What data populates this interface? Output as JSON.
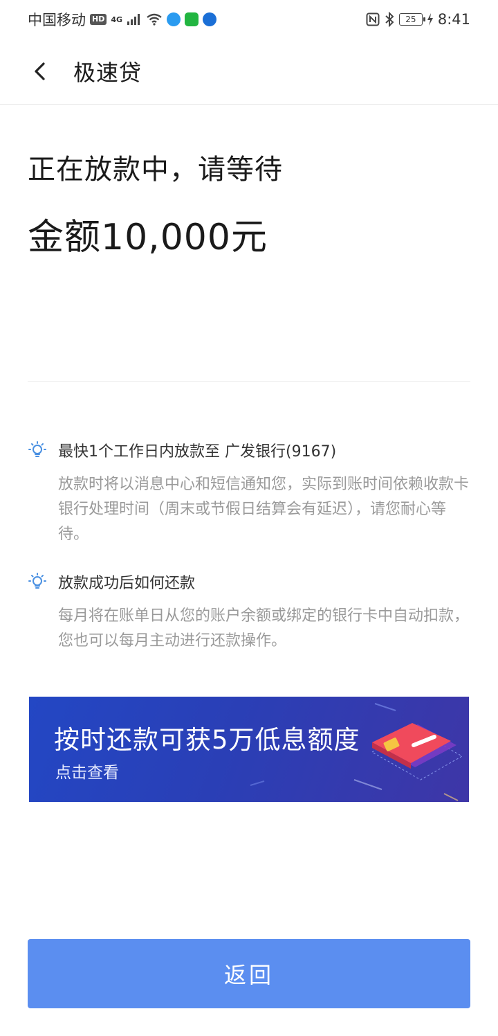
{
  "status_bar": {
    "carrier": "中国移动",
    "hd": "HD",
    "network": "4G",
    "battery_level": "25",
    "time": "8:41"
  },
  "header": {
    "title": "极速贷"
  },
  "status": {
    "title": "正在放款中，请等待",
    "amount_prefix": "金额",
    "amount_value": "10,000元"
  },
  "info": [
    {
      "heading": "最快1个工作日内放款至 广发银行(9167)",
      "body": "放款时将以消息中心和短信通知您，实际到账时间依赖收款卡银行处理时间（周末或节假日结算会有延迟），请您耐心等待。"
    },
    {
      "heading": "放款成功后如何还款",
      "body": "每月将在账单日从您的账户余额或绑定的银行卡中自动扣款，您也可以每月主动进行还款操作。"
    }
  ],
  "banner": {
    "title": "按时还款可获5万低息额度",
    "subtitle": "点击查看"
  },
  "actions": {
    "return_label": "返回"
  },
  "colors": {
    "primary_button": "#5b8ef0",
    "banner_start": "#2347c4",
    "banner_end": "#3e36a7",
    "bulb_icon": "#4a90e2"
  }
}
